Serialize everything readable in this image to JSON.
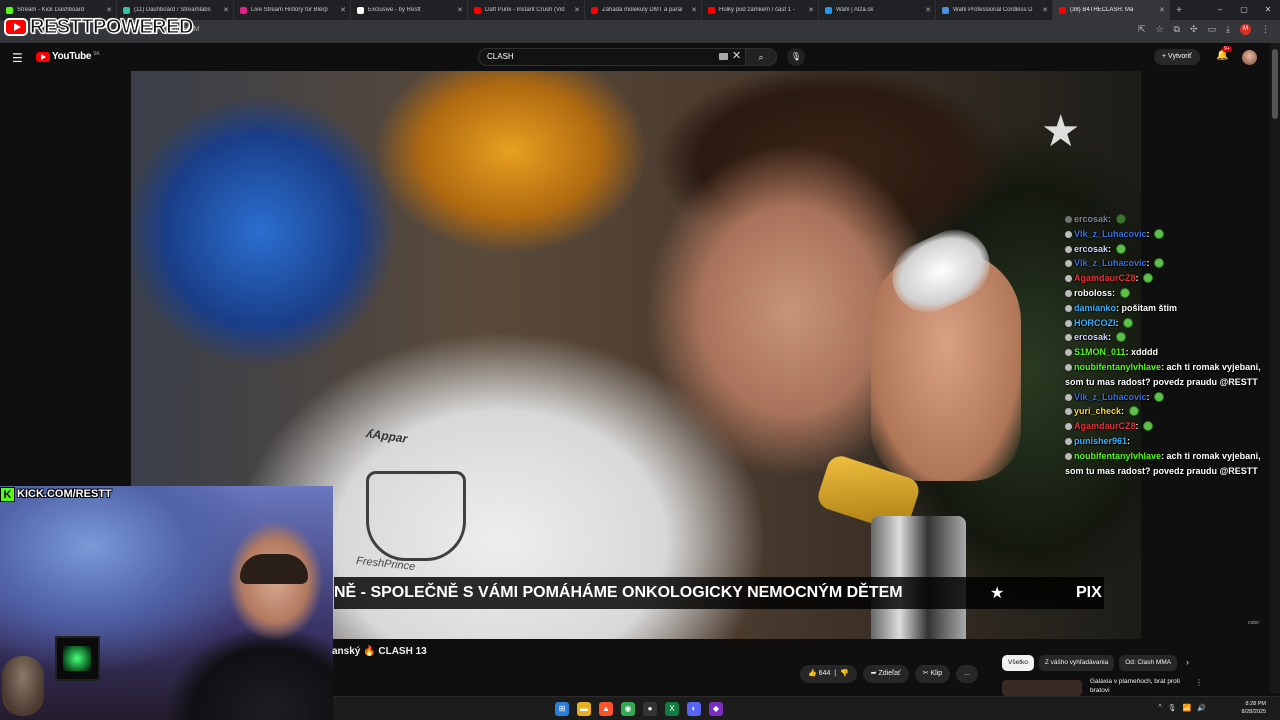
{
  "browser": {
    "tabs": [
      {
        "title": "Stream - Kick Dashboard",
        "color": "#53fc18"
      },
      {
        "title": "(11) Dashboard / Streamlabs",
        "color": "#31c3a2"
      },
      {
        "title": "Live Stream History for Blerp",
        "color": "#e0218a"
      },
      {
        "title": "Exclusive - by Restt",
        "color": "#ffffff"
      },
      {
        "title": "Daft Punk - Instant Crush (Vid",
        "color": "#ff0000"
      },
      {
        "title": "Záhada molekuly DMT a paral",
        "color": "#ff0000"
      },
      {
        "title": "Holky pod zámkem / část 1 -",
        "color": "#ff0000"
      },
      {
        "title": "Wahl | Alza.sk",
        "color": "#2196f3"
      },
      {
        "title": "Wahl Professional Cordless D",
        "color": "#4a90d9"
      },
      {
        "title": "(38) B4THECLASH: Ma",
        "color": "#ff0000"
      }
    ],
    "new_tab": "+",
    "url": "KuFHmM",
    "profile_initial": "M"
  },
  "overlay": {
    "brand": "RESTTPOWERED",
    "kick_label": "KICK.COM/RESTT"
  },
  "youtube": {
    "logo": "YouTube",
    "country": "SK",
    "search_value": "CLASH",
    "create_label": "Vytvoriť",
    "notif_count": "9+"
  },
  "chat": [
    {
      "user": "ercosak",
      "text": "",
      "color": "#cfd6ff",
      "emote": true,
      "hidden": true
    },
    {
      "user": "Vlk_z_Luhacovic",
      "text": "",
      "color": "#3b6fe0",
      "emote": true
    },
    {
      "user": "ercosak",
      "text": "",
      "color": "#cfd6ff",
      "emote": true
    },
    {
      "user": "Vlk_z_Luhacovic",
      "text": "",
      "color": "#3b6fe0",
      "emote": true
    },
    {
      "user": "AgamdaurCZ8",
      "text": "",
      "color": "#e8333a",
      "emote": true
    },
    {
      "user": "roboloss",
      "text": "",
      "color": "#ffffff",
      "emote": true
    },
    {
      "user": "damianko",
      "text": "pošitam štim",
      "color": "#3bb0ff",
      "emote": false
    },
    {
      "user": "HORCOZI",
      "text": "",
      "color": "#3bb0ff",
      "emote": true
    },
    {
      "user": "ercosak",
      "text": "",
      "color": "#cfd6ff",
      "emote": true
    },
    {
      "user": "S1MON_011",
      "text": "xdddd",
      "color": "#53fc18",
      "emote": false
    },
    {
      "user": "noubifentanylvhlave",
      "text": "ach ti romak vyjebani, som tu mas radost? povedz praudu @RESTT",
      "color": "#53fc18",
      "emote": false,
      "wrap": true
    },
    {
      "user": "Vlk_z_Luhacovic",
      "text": "",
      "color": "#3b6fe0",
      "emote": true
    },
    {
      "user": "yuri_check",
      "text": "",
      "color": "#ffd23b",
      "emote": true
    },
    {
      "user": "AgamdaurCZ8",
      "text": "",
      "color": "#e8333a",
      "emote": true
    },
    {
      "user": "punisher961",
      "text": "",
      "color": "#3bb0ff",
      "emote": false
    },
    {
      "user": "noubifentanylvhlave",
      "text": "ach ti romak vyjebani, som tu mas radost? povedz praudu @RESTT",
      "color": "#53fc18",
      "emote": false,
      "wrap": true
    }
  ],
  "ticker": {
    "text": "NĚ - SPOLEČNĚ S VÁMI POMÁHÁME ONKOLOGICKY NEMOCNÝM DĚTEM",
    "star": "★",
    "tail": "PIX"
  },
  "video": {
    "title": "anský 🔥 CLASH 13",
    "shirt_text": "ʎAppar",
    "shirt_text2": "FreshPrince",
    "corner_mark": "cuter"
  },
  "actions": {
    "likes": "644",
    "share": "Zdieľať",
    "clip": "Klip",
    "more": "..."
  },
  "chips": [
    "Všetko",
    "Z vášho vyhľadávania",
    "Od: Clash MMA"
  ],
  "recommended": {
    "title": "Galaxia v plameňoch, brat proti bratovi"
  },
  "taskbar": {
    "time": "8:28 PM",
    "date": "8/28/2025"
  }
}
